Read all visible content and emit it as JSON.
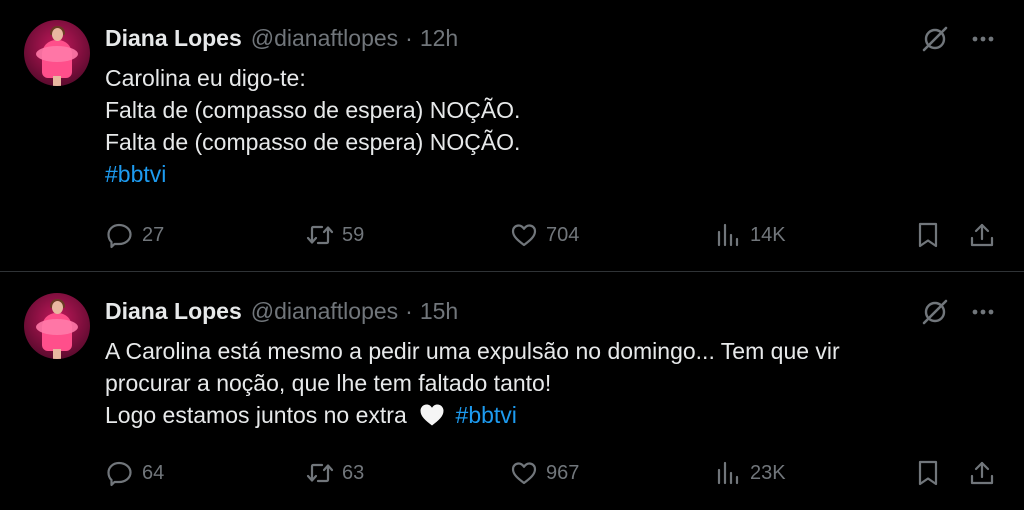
{
  "tweets": [
    {
      "author": {
        "name": "Diana Lopes",
        "handle": "@dianaftlopes",
        "separator": "·",
        "time": "12h"
      },
      "lines": [
        "Carolina eu digo-te:",
        "Falta de (compasso de espera) NOÇÃO.",
        "Falta de (compasso de espera) NOÇÃO."
      ],
      "hashtag": "#bbtvi",
      "stats": {
        "replies": "27",
        "retweets": "59",
        "likes": "704",
        "views": "14K"
      }
    },
    {
      "author": {
        "name": "Diana Lopes",
        "handle": "@dianaftlopes",
        "separator": "·",
        "time": "15h"
      },
      "lines": [
        "A Carolina está mesmo a pedir uma expulsão no domingo... Tem que vir",
        "procurar a noção, que lhe tem faltado tanto!"
      ],
      "last_line": "Logo estamos juntos no extra",
      "emoji": "white-heart-emoji",
      "hashtag": "#bbtvi",
      "stats": {
        "replies": "64",
        "retweets": "63",
        "likes": "967",
        "views": "23K"
      }
    }
  ],
  "icons": {
    "avatar": "avatar-image",
    "grok": "grok-icon",
    "more": "more-options-icon",
    "reply": "reply-icon",
    "retweet": "retweet-icon",
    "like": "heart-icon",
    "views": "views-icon",
    "bookmark": "bookmark-icon",
    "share": "share-icon"
  },
  "colors": {
    "background": "#000000",
    "text": "#e7e9ea",
    "secondary": "#71767b",
    "link": "#1d9bf0",
    "divider": "#2f3336"
  }
}
